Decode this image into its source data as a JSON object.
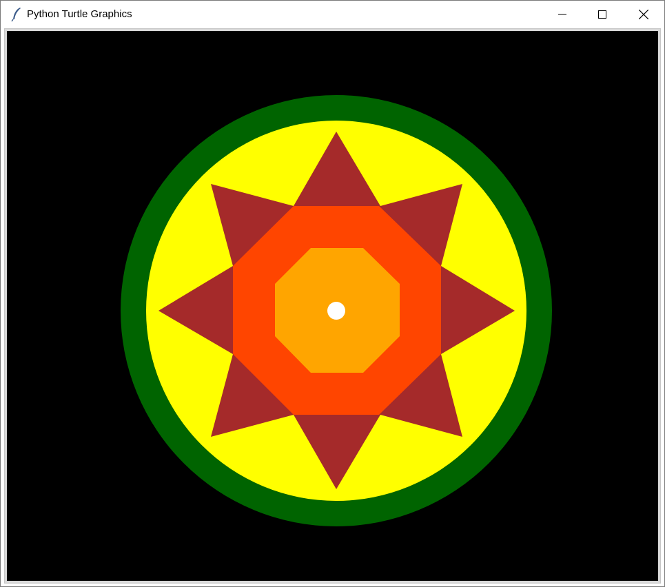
{
  "window": {
    "title": "Python Turtle Graphics",
    "icon": "feather-icon",
    "controls": [
      "minimize-icon",
      "maximize-icon",
      "close-icon"
    ]
  },
  "canvas": {
    "background": "#000000",
    "shapes": [
      {
        "name": "outer-ring",
        "color": "#006400"
      },
      {
        "name": "inner-disc",
        "color": "#ffff00"
      },
      {
        "name": "eight-point-star",
        "color": "#a52a2a"
      },
      {
        "name": "outer-octagon",
        "color": "#ff4500"
      },
      {
        "name": "inner-octagon",
        "color": "#ffa500"
      },
      {
        "name": "center-dot",
        "color": "#ffffff"
      }
    ]
  }
}
